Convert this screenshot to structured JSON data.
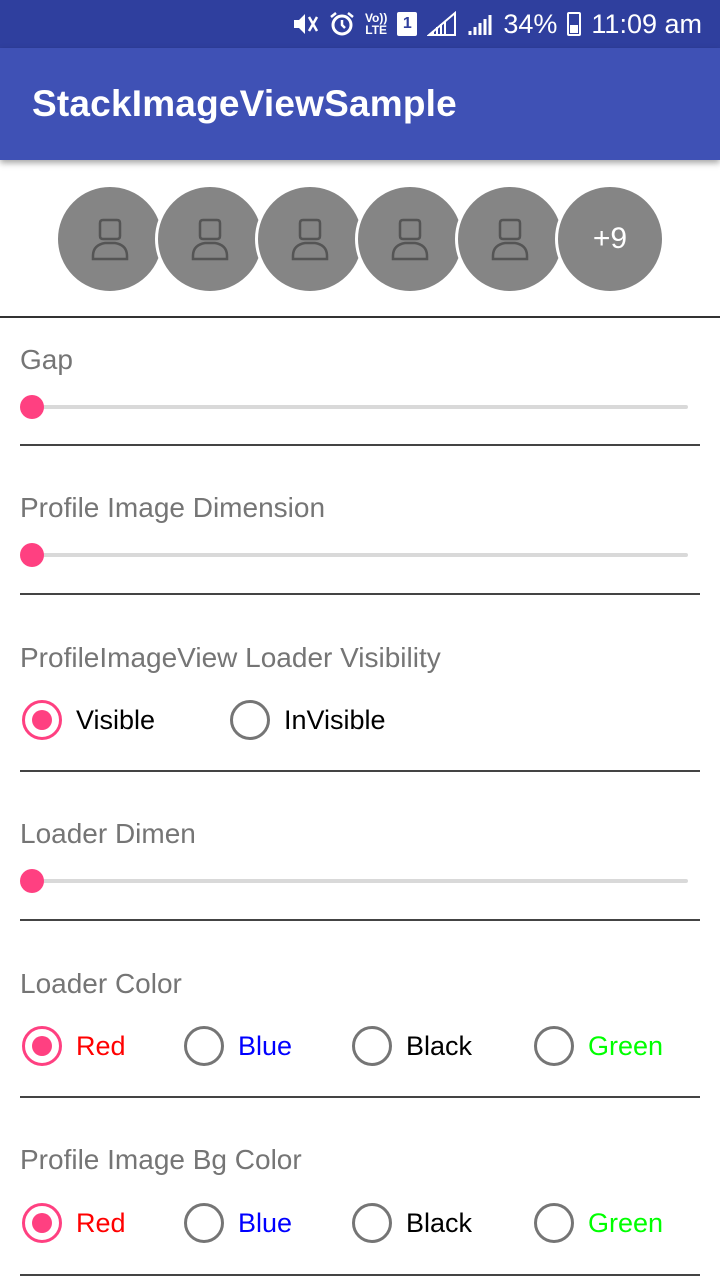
{
  "status_bar": {
    "mute_icon": "mute-icon",
    "alarm_icon": "alarm-icon",
    "volte_label_top": "Vo))",
    "volte_label_bottom": "LTE",
    "sim_label": "1",
    "battery_percent": "34%",
    "time": "11:09 am"
  },
  "app_bar": {
    "title": "StackImageViewSample"
  },
  "stack_view": {
    "avatar_icon": "person-icon",
    "avatar_count": 5,
    "more_label": "+9",
    "avatar_bg": "#858585"
  },
  "sections": {
    "gap": {
      "title": "Gap",
      "slider_value": 0
    },
    "profile_dimension": {
      "title": "Profile Image Dimension",
      "slider_value": 0
    },
    "loader_visibility": {
      "title": "ProfileImageView Loader Visibility",
      "options": [
        "Visible",
        "InVisible"
      ],
      "selected": "Visible"
    },
    "loader_dimen": {
      "title": "Loader Dimen",
      "slider_value": 0
    },
    "loader_color": {
      "title": "Loader Color",
      "options": [
        "Red",
        "Blue",
        "Black",
        "Green"
      ],
      "selected": "Red"
    },
    "profile_bg_color": {
      "title": "Profile Image Bg Color",
      "options": [
        "Red",
        "Blue",
        "Black",
        "Green"
      ],
      "selected": "Red"
    }
  },
  "colors": {
    "primary": "#3f51b5",
    "primary_dark": "#2f3f9e",
    "accent": "#ff4081",
    "red": "#ff0000",
    "blue": "#0000ff",
    "black": "#000000",
    "green": "#00ff00"
  }
}
